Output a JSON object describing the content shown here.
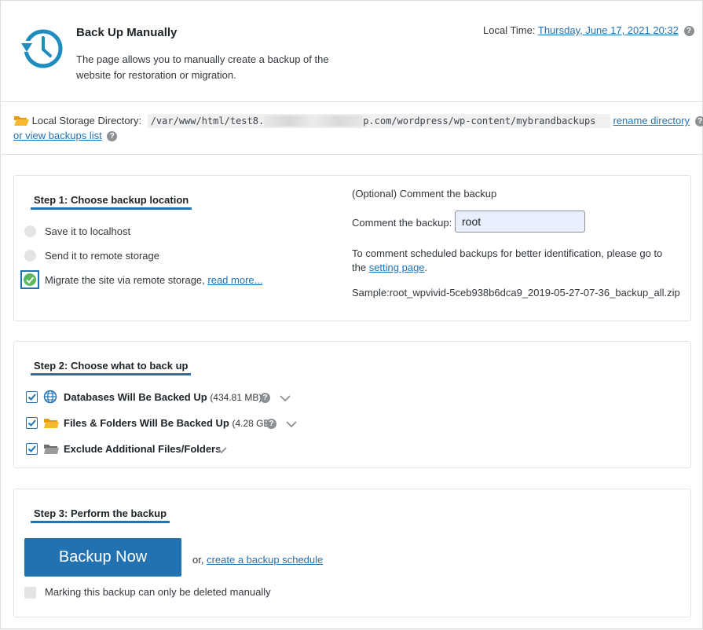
{
  "header": {
    "title": "Back Up Manually",
    "description_line1": "The page allows you to manually create a backup of the",
    "description_line2": "website for restoration or migration.",
    "local_time_label": "Local Time:",
    "local_time_value": "Thursday, June 17, 2021 20:32"
  },
  "storage": {
    "label": "Local Storage Directory:",
    "path_prefix": "/var/www/html/test8.",
    "path_suffix": "p.com/wordpress/wp-content/mybrandbackups",
    "rename_link": "rename directory",
    "view_list_link": "or view backups list"
  },
  "step1": {
    "title": "Step 1: Choose backup location",
    "options": [
      {
        "label": "Save it to localhost",
        "selected": false
      },
      {
        "label": "Send it to remote storage",
        "selected": false
      },
      {
        "label": "Migrate the site via remote storage,",
        "selected": true
      }
    ],
    "read_more": "read more...",
    "comment_heading": "(Optional) Comment the backup",
    "comment_label": "Comment the backup:",
    "comment_value": "root",
    "scheduled_note_line1": "To comment scheduled backups for better identification, please go to",
    "scheduled_note_prefix": "the",
    "setting_link": "setting page",
    "scheduled_note_suffix": ".",
    "sample": "Sample:root_wpvivid-5ceb938b6dca9_2019-05-27-07-36_backup_all.zip"
  },
  "step2": {
    "title": "Step 2: Choose what to back up",
    "items": [
      {
        "label": "Databases Will Be Backed Up",
        "size": "(434.81 MB)",
        "checked": true,
        "icon": "globe-icon"
      },
      {
        "label": "Files & Folders Will Be Backed Up",
        "size": "(4.28 GB)",
        "checked": true,
        "icon": "folder-icon"
      },
      {
        "label": "Exclude Additional Files/Folders",
        "size": "",
        "checked": true,
        "icon": "folder-gray-icon"
      }
    ]
  },
  "step3": {
    "title": "Step 3: Perform the backup",
    "button": "Backup Now",
    "or_text": "or,",
    "schedule_link": "create a backup schedule",
    "manual_note": "Marking this backup can only be deleted manually"
  },
  "colors": {
    "accent": "#2271b1",
    "check_green": "#5cb85c",
    "folder_yellow": "#f0a30a"
  }
}
